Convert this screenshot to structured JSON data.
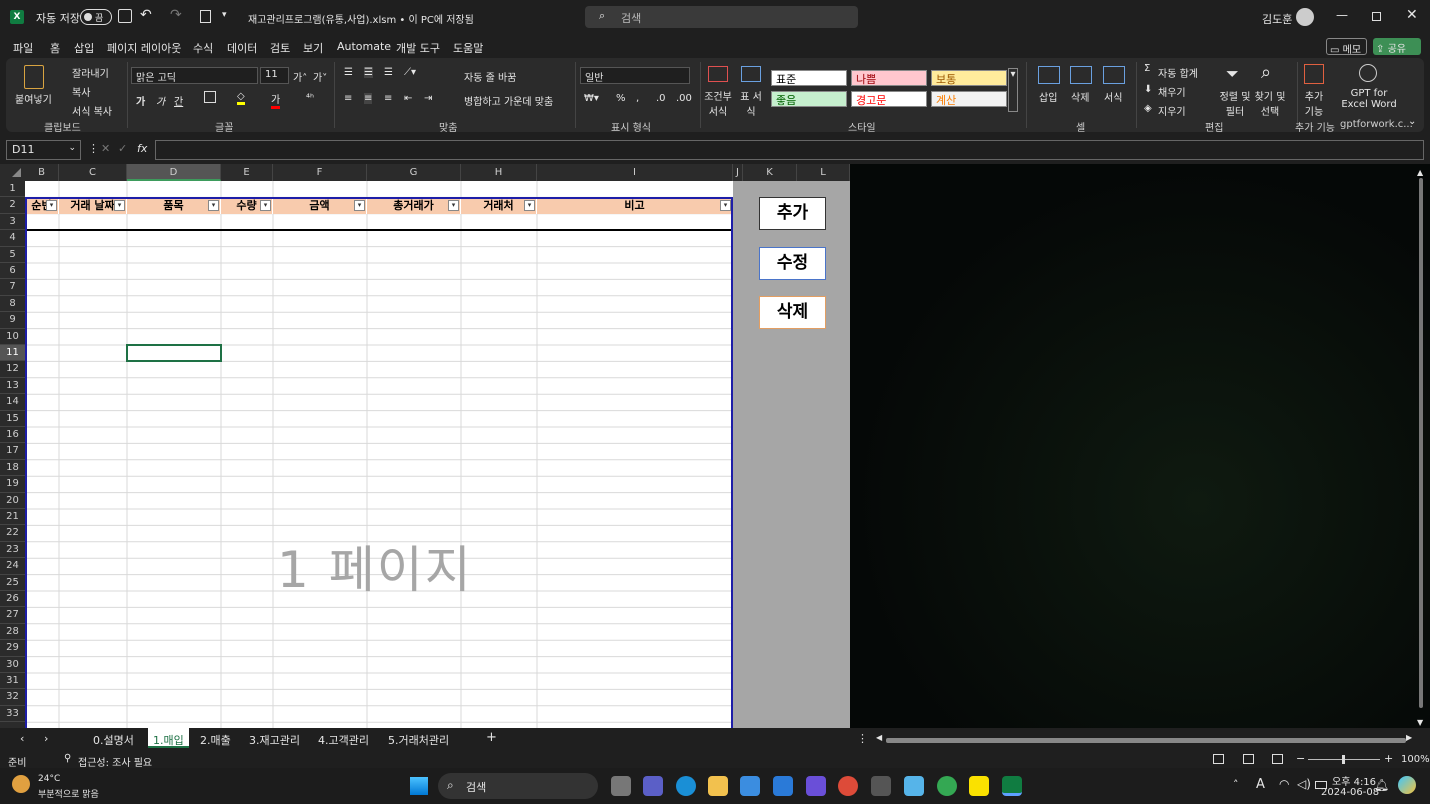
{
  "app": {
    "autosave_label": "자동 저장",
    "autosave_toggle": "끔",
    "filename": "재고관리프로그램(유통,사업).xlsm • 이 PC에 저장됨",
    "search_placeholder": "검색",
    "user": "김도훈"
  },
  "menu": [
    "파일",
    "홈",
    "삽입",
    "페이지 레이아웃",
    "수식",
    "데이터",
    "검토",
    "보기",
    "Automate",
    "개발 도구",
    "도움말"
  ],
  "menu_right": {
    "memo": "메모",
    "share": "공유"
  },
  "ribbon": {
    "clipboard": {
      "paste": "붙여넣기",
      "cut": "잘라내기",
      "copy": "복사",
      "format_painter": "서식 복사",
      "label": "클립보드"
    },
    "font": {
      "name": "맑은 고딕",
      "size": "11",
      "label": "글꼴",
      "bold": "가",
      "italic": "가",
      "underline": "간"
    },
    "align": {
      "wrap": "자동 줄 바꿈",
      "merge": "병합하고 가운데 맞춤",
      "label": "맞춤"
    },
    "number": {
      "format": "일반",
      "label": "표시 형식"
    },
    "styles": {
      "conditional": "조건부 서식",
      "table": "표 서식",
      "cells": [
        {
          "text": "표준",
          "bg": "#ffffff",
          "fg": "#000000"
        },
        {
          "text": "나쁨",
          "bg": "#ffc7ce",
          "fg": "#9c0006"
        },
        {
          "text": "보통",
          "bg": "#ffeb9c",
          "fg": "#9c5700"
        },
        {
          "text": "좋음",
          "bg": "#c6efce",
          "fg": "#006100"
        },
        {
          "text": "경고문",
          "bg": "#ffffff",
          "fg": "#ff0000"
        },
        {
          "text": "계산",
          "bg": "#f2f2f2",
          "fg": "#fa7d00"
        }
      ],
      "label": "스타일"
    },
    "cells": {
      "insert": "삽입",
      "delete": "삭제",
      "format": "서식",
      "label": "셀"
    },
    "edit": {
      "autosum": "자동 합계",
      "fill": "채우기",
      "clear": "지우기",
      "sort": "정렬 및 필터",
      "find": "찾기 및 선택",
      "label": "편집"
    },
    "addins": {
      "add": "추가 기능",
      "label": "추가 기능"
    },
    "gpt": {
      "name": "GPT for Excel Word",
      "label": "gptforwork.c..."
    }
  },
  "formula": {
    "cell_ref": "D11",
    "fx": "fx",
    "value": ""
  },
  "columns": [
    "B",
    "C",
    "D",
    "E",
    "F",
    "G",
    "H",
    "I",
    "J",
    "K",
    "L"
  ],
  "rows": [
    "1",
    "2",
    "3",
    "4",
    "5",
    "6",
    "7",
    "8",
    "9",
    "10",
    "11",
    "12",
    "13",
    "14",
    "15",
    "16",
    "17",
    "18",
    "19",
    "20",
    "21",
    "22",
    "23",
    "24",
    "25",
    "26",
    "27",
    "28",
    "29",
    "30",
    "31",
    "32",
    "33"
  ],
  "table_headers": [
    "순번",
    "거래 날짜",
    "품목",
    "수량",
    "금액",
    "총거래가",
    "거래처",
    "비고"
  ],
  "watermark": "1 페이지",
  "buttons": {
    "add": "추가",
    "edit": "수정",
    "delete": "삭제"
  },
  "sheets": [
    "0.설명서",
    "1.매입",
    "2.매출",
    "3.재고관리",
    "4.고객관리",
    "5.거래처관리"
  ],
  "active_sheet": "1.매입",
  "status": {
    "ready": "준비",
    "accessibility": "접근성: 조사 필요",
    "zoom": "100%"
  },
  "taskbar": {
    "temp": "24°C",
    "weather": "부분적으로 맑음",
    "search": "검색",
    "time": "오후 4:16",
    "date": "2024-06-08"
  }
}
